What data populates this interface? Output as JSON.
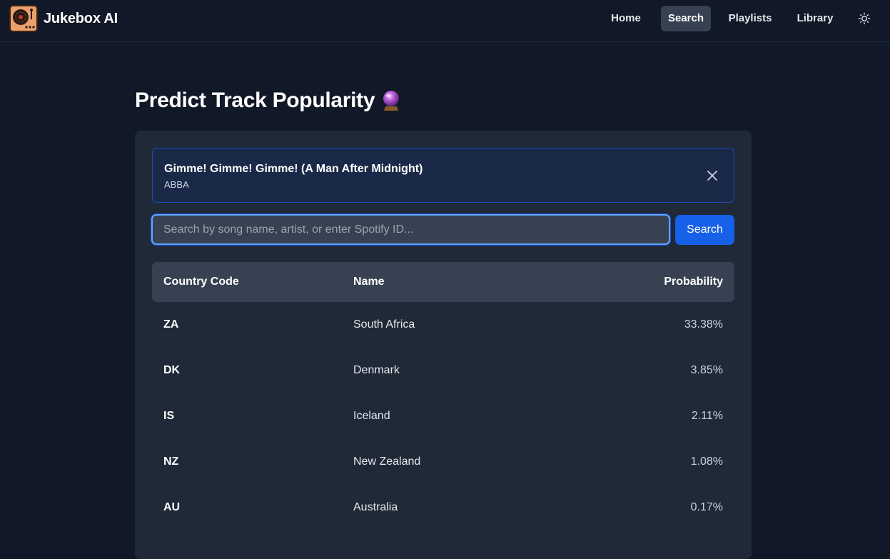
{
  "app": {
    "name": "Jukebox AI"
  },
  "nav": {
    "items": [
      {
        "label": "Home"
      },
      {
        "label": "Search"
      },
      {
        "label": "Playlists"
      },
      {
        "label": "Library"
      }
    ],
    "active": "Search",
    "theme_icon": "sun-icon"
  },
  "page": {
    "title": "Predict Track Popularity",
    "title_icon": "crystal-ball-icon"
  },
  "selected_track": {
    "title": "Gimme! Gimme! Gimme! (A Man After Midnight)",
    "artist": "ABBA"
  },
  "search": {
    "placeholder": "Search by song name, artist, or enter Spotify ID...",
    "value": "",
    "button_label": "Search"
  },
  "table": {
    "headers": {
      "code": "Country Code",
      "name": "Name",
      "probability": "Probability"
    },
    "rows": [
      {
        "code": "ZA",
        "name": "South Africa",
        "probability": "33.38%"
      },
      {
        "code": "DK",
        "name": "Denmark",
        "probability": "3.85%"
      },
      {
        "code": "IS",
        "name": "Iceland",
        "probability": "2.11%"
      },
      {
        "code": "NZ",
        "name": "New Zealand",
        "probability": "1.08%"
      },
      {
        "code": "AU",
        "name": "Australia",
        "probability": "0.17%"
      }
    ]
  },
  "colors": {
    "background": "#111827",
    "card": "#1f2937",
    "accent": "#1661e8",
    "selected_border": "#1e4bb8"
  }
}
